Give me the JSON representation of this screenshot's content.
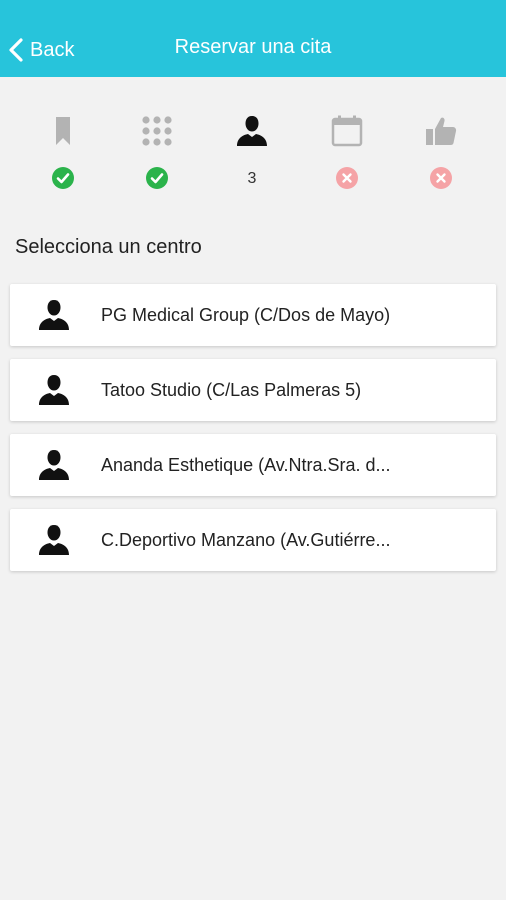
{
  "navbar": {
    "back_label": "Back",
    "title": "Reservar una cita",
    "color": "#27c4db"
  },
  "steps": [
    {
      "icon": "bookmark-icon",
      "status": "done"
    },
    {
      "icon": "grid-icon",
      "status": "done"
    },
    {
      "icon": "user-icon",
      "status": "current",
      "number": "3"
    },
    {
      "icon": "calendar-icon",
      "status": "pending"
    },
    {
      "icon": "thumbs-up-icon",
      "status": "pending"
    }
  ],
  "status_colors": {
    "done": "#2bb34b",
    "pending": "#f5a3a6",
    "inactive_icon": "#b3b3b3",
    "active_icon": "#111111"
  },
  "section_title": "Selecciona un centro",
  "centers": [
    {
      "icon": "user-icon",
      "name": "PG Medical Group (C/Dos de Mayo)"
    },
    {
      "icon": "user-icon",
      "name": "Tatoo Studio (C/Las Palmeras 5)"
    },
    {
      "icon": "user-icon",
      "name": "Ananda Esthetique (Av.Ntra.Sra. d..."
    },
    {
      "icon": "user-icon",
      "name": "C.Deportivo Manzano (Av.Gutiérre..."
    }
  ]
}
